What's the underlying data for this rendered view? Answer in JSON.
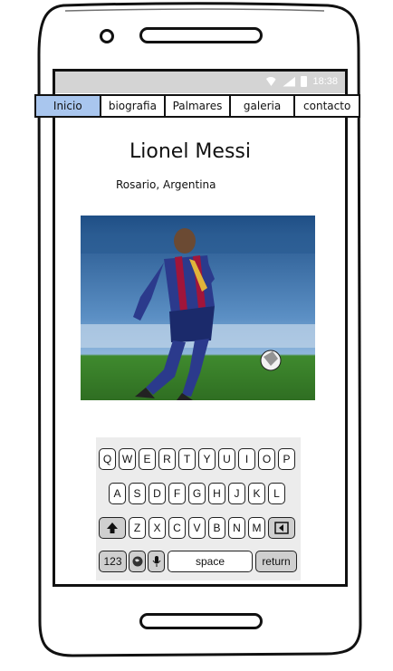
{
  "status_bar": {
    "time": "18:38"
  },
  "nav": {
    "tabs": [
      {
        "label": "Inicio",
        "active": true
      },
      {
        "label": "biografia"
      },
      {
        "label": "Palmares"
      },
      {
        "label": "galeria"
      },
      {
        "label": "contacto"
      }
    ]
  },
  "profile": {
    "name": "Lionel Messi",
    "birthplace": "Rosario, Argentina"
  },
  "keyboard": {
    "row1": [
      "Q",
      "W",
      "E",
      "R",
      "T",
      "Y",
      "U",
      "I",
      "O",
      "P"
    ],
    "row2": [
      "A",
      "S",
      "D",
      "F",
      "G",
      "H",
      "J",
      "K",
      "L"
    ],
    "row3": [
      "Z",
      "X",
      "C",
      "V",
      "B",
      "N",
      "M"
    ],
    "numbers_label": "123",
    "space_label": "space",
    "return_label": "return"
  },
  "colors": {
    "active_tab": "#a9c6ee",
    "status_bar": "#d4d4d4"
  }
}
